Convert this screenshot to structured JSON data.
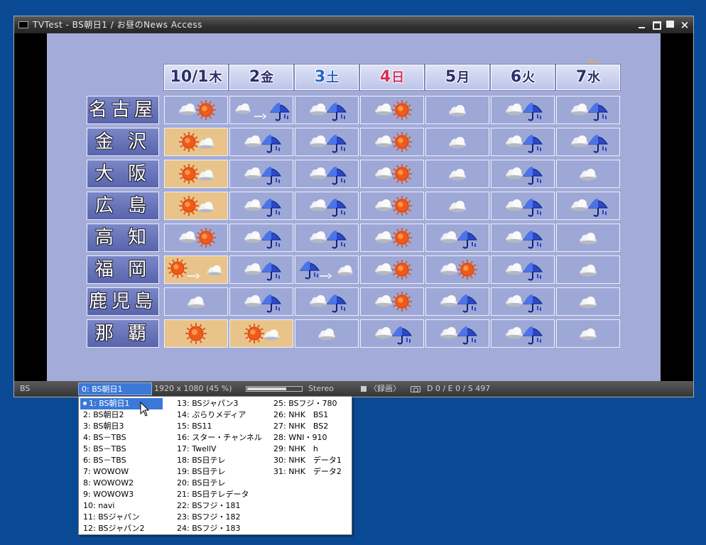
{
  "window": {
    "title": "TVTest - BS朝日1 / お昼のNews  Access"
  },
  "broadcast": {
    "logo": "BS",
    "days": [
      {
        "date": "10/1",
        "dow": "木",
        "kind": "weekday"
      },
      {
        "date": "2",
        "dow": "金",
        "kind": "weekday"
      },
      {
        "date": "3",
        "dow": "土",
        "kind": "sat"
      },
      {
        "date": "4",
        "dow": "日",
        "kind": "sun"
      },
      {
        "date": "5",
        "dow": "月",
        "kind": "weekday"
      },
      {
        "date": "6",
        "dow": "火",
        "kind": "weekday"
      },
      {
        "date": "7",
        "dow": "水",
        "kind": "weekday"
      }
    ],
    "cities": [
      {
        "name": "名古屋",
        "forecast": [
          "cloud-sun",
          "cloud-to-rain",
          "cloud-rain",
          "cloud-sun",
          "cloud",
          "cloud-rain",
          "cloud-rain"
        ],
        "highlight": []
      },
      {
        "name": "金 沢",
        "forecast": [
          "sun-cloud",
          "cloud-rain",
          "cloud-rain",
          "cloud-sun",
          "cloud",
          "cloud-rain",
          "cloud-rain"
        ],
        "highlight": [
          0
        ]
      },
      {
        "name": "大 阪",
        "forecast": [
          "sun-cloud",
          "cloud-rain",
          "cloud-rain",
          "cloud-sun",
          "cloud",
          "cloud-rain",
          "cloud"
        ],
        "highlight": [
          0
        ]
      },
      {
        "name": "広 島",
        "forecast": [
          "sun-cloud",
          "cloud-rain",
          "cloud-rain",
          "cloud-sun",
          "cloud",
          "cloud-rain",
          "cloud-rain"
        ],
        "highlight": [
          0
        ]
      },
      {
        "name": "高 知",
        "forecast": [
          "cloud-sun",
          "cloud-rain",
          "cloud-rain",
          "cloud-sun",
          "cloud-rain",
          "cloud-rain",
          "cloud"
        ],
        "highlight": []
      },
      {
        "name": "福 岡",
        "forecast": [
          "sun-to-cloud",
          "cloud-rain",
          "rain-to-cloud",
          "cloud-sun",
          "cloud-sun",
          "cloud-rain",
          "cloud"
        ],
        "highlight": [
          0
        ]
      },
      {
        "name": "鹿児島",
        "forecast": [
          "cloud",
          "cloud-rain",
          "cloud-rain",
          "cloud-sun",
          "cloud-rain",
          "cloud-rain",
          "cloud"
        ],
        "highlight": []
      },
      {
        "name": "那 覇",
        "forecast": [
          "sun",
          "sun-cloud",
          "cloud",
          "cloud-rain",
          "cloud-rain",
          "cloud-rain",
          "cloud"
        ],
        "highlight": [
          0,
          1
        ]
      }
    ]
  },
  "statusbar": {
    "space": "BS",
    "channel": "0: BS朝日1",
    "resolution": "1920 x 1080 (45 %)",
    "volume": 0.7,
    "audio": "Stereo",
    "record": "〈録画〉",
    "errors": "D 0 / E 0 / S 497"
  },
  "channel_menu": {
    "selected_index": 0,
    "columns": [
      [
        "1: BS朝日1",
        "2: BS朝日2",
        "3: BS朝日3",
        "4: BS－TBS",
        "5: BS－TBS",
        "6: BS－TBS",
        "7: WOWOW",
        "8: WOWOW2",
        "9: WOWOW3",
        "10: navi",
        "11: BSジャパン",
        "12: BSジャパン2"
      ],
      [
        "13: BSジャパン3",
        "14: ぷらりメディア",
        "15: BS11",
        "16: スター・チャンネル",
        "17: TwellV",
        "18: BS日テレ",
        "19: BS日テレ",
        "20: BS日テレ",
        "21: BS日テレデータ",
        "22: BSフジ・181",
        "23: BSフジ・182",
        "24: BSフジ・183"
      ],
      [
        "25: BSフジ・780",
        "26: NHK　BS1",
        "27: NHK　BS2",
        "28: WNI・910",
        "29: NHK　h",
        "30: NHK　データ1",
        "31: NHK　データ2"
      ]
    ]
  },
  "colors": {
    "desktop": "#0a4a94",
    "selection": "#3b78d8",
    "screen_bg": "#a3acd8",
    "highlight_cell": "#e8c48a"
  }
}
